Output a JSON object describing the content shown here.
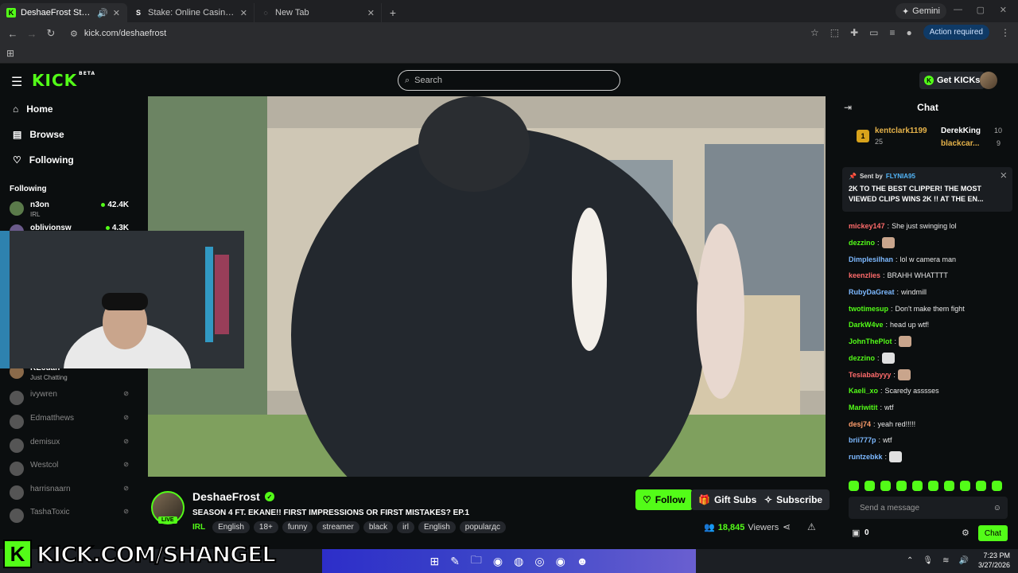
{
  "browser": {
    "tabs": [
      {
        "title": "DeshaeFrost Stream - Watch",
        "favicon": "K",
        "color": "#53fc18"
      },
      {
        "title": "Stake: Online Casino & Sports",
        "favicon": "S",
        "color": "#ffffff"
      },
      {
        "title": "New Tab",
        "favicon": "◌",
        "color": "#aaaaaa"
      }
    ],
    "gemini_label": "Gemini",
    "url": "kick.com/deshaefrost",
    "action_required": "Action required"
  },
  "header": {
    "logo": "KICK",
    "beta": "BETA",
    "search_placeholder": "Search",
    "get_kicks": "Get KICKs"
  },
  "sidebar": {
    "nav": [
      {
        "label": "Home",
        "icon": "home-icon"
      },
      {
        "label": "Browse",
        "icon": "browse-icon"
      },
      {
        "label": "Following",
        "icon": "heart-icon"
      }
    ],
    "section_title": "Following",
    "channels": [
      {
        "name": "n3on",
        "category": "IRL",
        "viewers": "42.4K",
        "live": true,
        "color": "#5a7a4a"
      },
      {
        "name": "oblivionsw",
        "category": "",
        "viewers": "4.3K",
        "live": true,
        "color": "#6a5a8a"
      },
      {
        "name": "KEcuan",
        "category": "Just Chatting",
        "viewers": "",
        "live": true,
        "color": "#8a6a4a"
      },
      {
        "name": "ivywren",
        "category": "",
        "viewers": "",
        "live": false,
        "color": "#555"
      },
      {
        "name": "Edmatthews",
        "category": "",
        "viewers": "",
        "live": false,
        "color": "#555"
      },
      {
        "name": "demisux",
        "category": "",
        "viewers": "",
        "live": false,
        "color": "#555"
      },
      {
        "name": "Westcol",
        "category": "",
        "viewers": "",
        "live": false,
        "color": "#555"
      },
      {
        "name": "harrisnaarn",
        "category": "",
        "viewers": "",
        "live": false,
        "color": "#555"
      },
      {
        "name": "TashaToxic",
        "category": "",
        "viewers": "",
        "live": false,
        "color": "#555"
      }
    ]
  },
  "stream": {
    "channel": "DeshaeFrost",
    "live_badge": "LIVE",
    "title": "SEASON 4 FT. EKANE!! FIRST IMPRESSIONS OR FIRST MISTAKES? EP.1",
    "category": "IRL",
    "tags": [
      "English",
      "18+",
      "funny",
      "streamer",
      "black",
      "irl",
      "English",
      "popularдc"
    ],
    "follow_label": "Follow",
    "gift_label": "Gift Subs",
    "subscribe_label": "Subscribe",
    "viewer_count": "18,845",
    "viewers_label": "Viewers"
  },
  "chat": {
    "title": "Chat",
    "leaderboard": [
      {
        "rank": "1",
        "name": "kentclark1199",
        "score": "25"
      },
      {
        "name": "DerekKing",
        "score": "10"
      },
      {
        "name": "blackcar...",
        "score": "9"
      }
    ],
    "pinned": {
      "sent_by_label": "Sent by",
      "sender": "FLYNIA95",
      "message": "2K TO THE BEST CLIPPER! THE MOST VIEWED CLIPS WINS 2K !! AT THE EN..."
    },
    "messages": [
      {
        "user": "mickey147",
        "text": "She just swinging lol",
        "color": "#ff6b6b"
      },
      {
        "user": "dezzino",
        "text": "",
        "color": "#53fc18",
        "emote": true
      },
      {
        "user": "Dimplesilhan",
        "text": "lol w camera man",
        "color": "#7db9ff"
      },
      {
        "user": "keenzlies",
        "text": "BRAHH WHATTTT",
        "color": "#ff6b6b"
      },
      {
        "user": "RubyDaGreat",
        "text": "windmill",
        "color": "#7db9ff"
      },
      {
        "user": "twotimesup",
        "text": "Don't make them fight",
        "color": "#53fc18"
      },
      {
        "user": "DarkW4ve",
        "text": "head up wtf!",
        "color": "#53fc18"
      },
      {
        "user": "JohnThePlot",
        "text": "",
        "color": "#53fc18",
        "emote": true
      },
      {
        "user": "dezzino",
        "text": "",
        "color": "#53fc18",
        "emote": true
      },
      {
        "user": "Tesiababyyy",
        "text": "",
        "color": "#ff6b6b",
        "emote": true
      },
      {
        "user": "Kaeli_xo",
        "text": "Scaredy asssses",
        "color": "#53fc18"
      },
      {
        "user": "Mariwitit",
        "text": "wtf",
        "color": "#53fc18"
      },
      {
        "user": "desj74",
        "text": "yeah red!!!!!",
        "color": "#ff9d6b"
      },
      {
        "user": "brii777p",
        "text": "wtf",
        "color": "#7db9ff"
      },
      {
        "user": "runtzebkk",
        "text": "",
        "color": "#7db9ff",
        "emote": true
      }
    ],
    "input_placeholder": "Send a message",
    "kicks_count": "0",
    "send_label": "Chat"
  },
  "overlay": {
    "k": "K",
    "text": "KICK.COM/SHANGEL"
  },
  "taskbar": {
    "time": "7:23 PM",
    "date": "3/27/2026"
  }
}
